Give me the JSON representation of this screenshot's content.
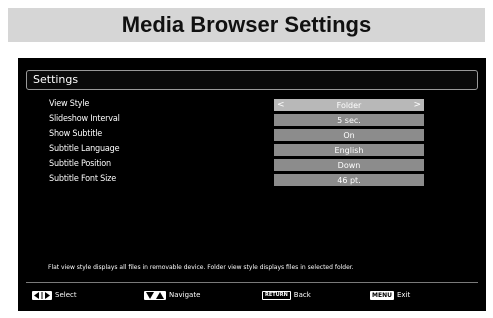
{
  "page_title": "Media Browser Settings",
  "panel": {
    "title": "Settings",
    "rows": [
      {
        "label": "View Style",
        "value": "Folder",
        "has_arrows": true,
        "active": true
      },
      {
        "label": "Slideshow Interval",
        "value": "5 sec."
      },
      {
        "label": "Show Subtitle",
        "value": "On"
      },
      {
        "label": "Subtitle Language",
        "value": "English"
      },
      {
        "label": "Subtitle Position",
        "value": "Down"
      },
      {
        "label": "Subtitle Font Size",
        "value": "46 pt."
      }
    ],
    "arrow_left": "<",
    "arrow_right": ">",
    "info_text": "Flat view style displays all files in removable device. Folder view style displays files in selected folder."
  },
  "footer": {
    "select": {
      "icon": "left-right-arrow-keys-icon",
      "label": "Select"
    },
    "navigate": {
      "icon": "up-down-arrow-keys-icon",
      "label": "Navigate"
    },
    "back": {
      "key": "RETURN",
      "label": "Back"
    },
    "exit": {
      "key": "MENU",
      "label": "Exit"
    }
  },
  "colors": {
    "header_bg": "#d6d6d6",
    "screen_bg": "#000000",
    "value_bg": "#8c8c8c",
    "value_active_bg": "#b8b8b8"
  }
}
